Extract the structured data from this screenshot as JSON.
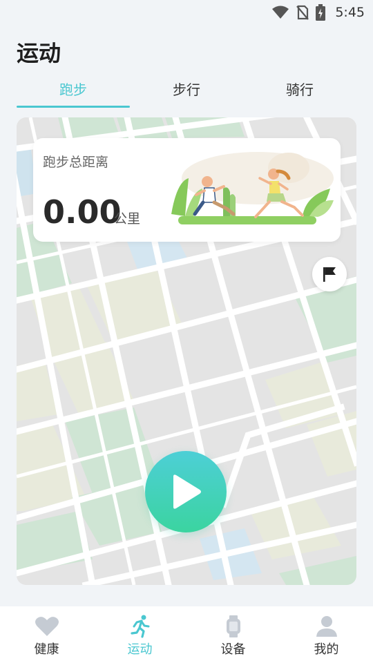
{
  "status_bar": {
    "time": "5:45"
  },
  "page": {
    "title": "运动"
  },
  "tabs": [
    {
      "label": "跑步",
      "active": true
    },
    {
      "label": "步行",
      "active": false
    },
    {
      "label": "骑行",
      "active": false
    }
  ],
  "stats": {
    "label": "跑步总距离",
    "value": "0.00",
    "unit": "公里"
  },
  "bottom_nav": [
    {
      "label": "健康",
      "icon": "heart-icon",
      "active": false
    },
    {
      "label": "运动",
      "icon": "running-icon",
      "active": true
    },
    {
      "label": "设备",
      "icon": "watch-icon",
      "active": false
    },
    {
      "label": "我的",
      "icon": "person-icon",
      "active": false
    }
  ],
  "colors": {
    "accent": "#4ac7d0",
    "play_gradient_start": "#4dcfd6",
    "play_gradient_end": "#3bd4a0"
  }
}
